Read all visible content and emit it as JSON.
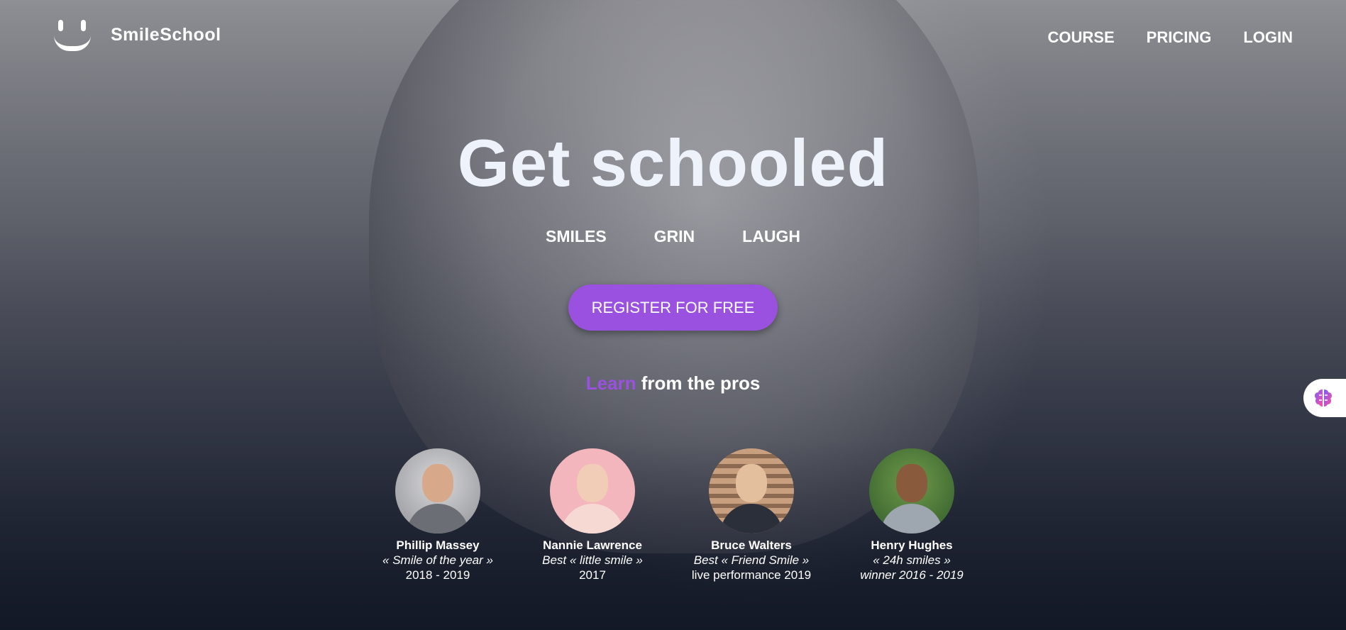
{
  "brand": {
    "name": "SmileSchool"
  },
  "nav": {
    "items": [
      "COURSE",
      "PRICING",
      "LOGIN"
    ]
  },
  "hero": {
    "title": "Get schooled",
    "tags": [
      "SMILES",
      "GRIN",
      "LAUGH"
    ],
    "cta_label": "REGISTER FOR FREE",
    "subtitle_accent": "Learn",
    "subtitle_rest": "from the pros"
  },
  "people": [
    {
      "name": "Phillip Massey",
      "award": "« Smile of the year »",
      "year": "2018 - 2019"
    },
    {
      "name": "Nannie Lawrence",
      "award": "Best « little smile »",
      "year": "2017"
    },
    {
      "name": "Bruce Walters",
      "award": "Best « Friend Smile »",
      "year": "live performance 2019"
    },
    {
      "name": "Henry Hughes",
      "award": "« 24h smiles »",
      "year": "winner 2016 - 2019"
    }
  ],
  "colors": {
    "accent": "#9b51e0",
    "title": "#eef3fb"
  },
  "icons": {
    "side_tab": "brain-icon"
  }
}
